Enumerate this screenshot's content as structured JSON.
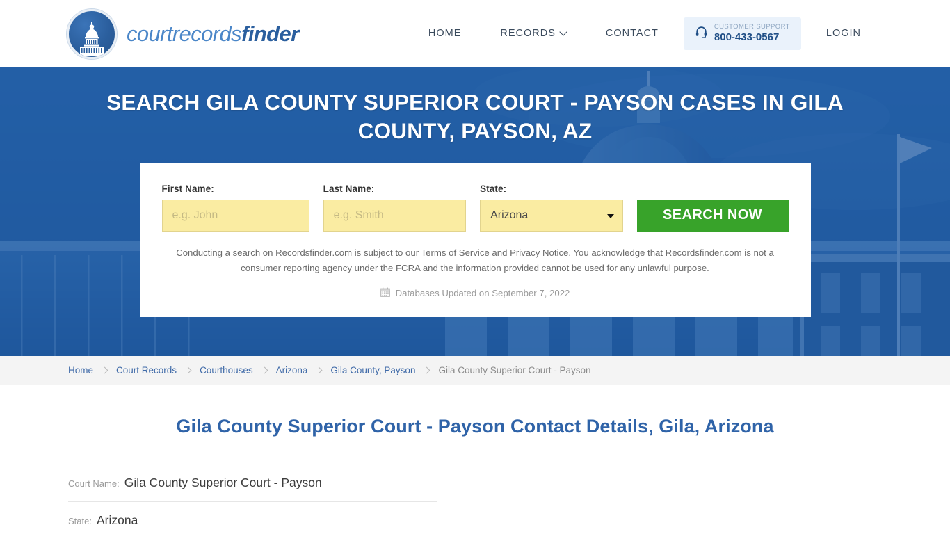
{
  "header": {
    "logo": {
      "icon": "capitol-dome-icon",
      "word_part1": "courtrecords",
      "word_part2": "finder"
    },
    "nav": [
      {
        "label": "HOME",
        "has_dropdown": false
      },
      {
        "label": "RECORDS",
        "has_dropdown": true
      },
      {
        "label": "CONTACT",
        "has_dropdown": false
      }
    ],
    "support": {
      "icon": "headset-icon",
      "label": "CUSTOMER SUPPORT",
      "phone": "800-433-0567"
    },
    "login": {
      "label": "LOGIN"
    }
  },
  "hero": {
    "title": "SEARCH GILA COUNTY SUPERIOR COURT - PAYSON CASES IN GILA COUNTY, PAYSON, AZ",
    "background_color": "#2660aa"
  },
  "search_form": {
    "first_name": {
      "label": "First Name:",
      "value": "",
      "placeholder": "e.g. John"
    },
    "last_name": {
      "label": "Last Name:",
      "value": "",
      "placeholder": "e.g. Smith"
    },
    "state": {
      "label": "State:",
      "value": "Arizona",
      "options": [
        "Arizona"
      ]
    },
    "submit_label": "SEARCH NOW",
    "submit_color": "#38a32a",
    "input_color": "#faeca2",
    "disclaimer": {
      "part1": "Conducting a search on Recordsfinder.com is subject to our ",
      "link1": "Terms of Service",
      "part2": " and ",
      "link2": "Privacy Notice",
      "part3": ". You acknowledge that Recordsfinder.com is not a consumer reporting agency under the FCRA and the information provided cannot be used for any unlawful purpose."
    },
    "db_updated": {
      "icon": "calendar-icon",
      "text": "Databases Updated on September 7, 2022"
    }
  },
  "breadcrumb": [
    {
      "label": "Home",
      "current": false
    },
    {
      "label": "Court Records",
      "current": false
    },
    {
      "label": "Courthouses",
      "current": false
    },
    {
      "label": "Arizona",
      "current": false
    },
    {
      "label": "Gila County, Payson",
      "current": false
    },
    {
      "label": "Gila County Superior Court - Payson",
      "current": true
    }
  ],
  "main": {
    "page_title": "Gila County Superior Court - Payson Contact Details, Gila, Arizona",
    "details": [
      {
        "label": "Court Name:",
        "value": "Gila County Superior Court - Payson"
      },
      {
        "label": "State:",
        "value": "Arizona"
      }
    ]
  }
}
